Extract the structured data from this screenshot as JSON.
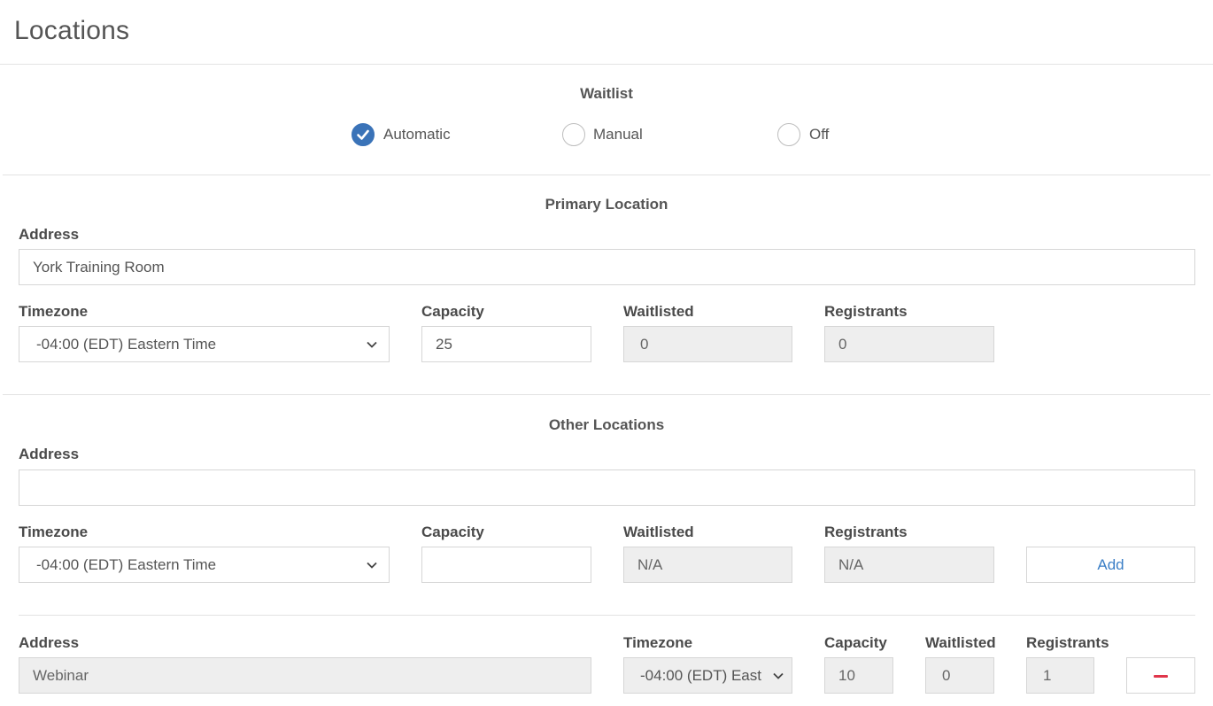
{
  "page": {
    "title": "Locations"
  },
  "waitlist": {
    "title": "Waitlist",
    "options": [
      {
        "label": "Automatic",
        "checked": true
      },
      {
        "label": "Manual",
        "checked": false
      },
      {
        "label": "Off",
        "checked": false
      }
    ]
  },
  "primary": {
    "title": "Primary Location",
    "address_label": "Address",
    "address_value": "York Training Room",
    "timezone_label": "Timezone",
    "timezone_value": "-04:00 (EDT) Eastern Time",
    "capacity_label": "Capacity",
    "capacity_value": "25",
    "waitlisted_label": "Waitlisted",
    "waitlisted_value": "0",
    "registrants_label": "Registrants",
    "registrants_value": "0"
  },
  "other": {
    "title": "Other Locations",
    "address_label": "Address",
    "address_value": "",
    "timezone_label": "Timezone",
    "timezone_value": "-04:00 (EDT) Eastern Time",
    "capacity_label": "Capacity",
    "capacity_value": "",
    "waitlisted_label": "Waitlisted",
    "waitlisted_value": "N/A",
    "registrants_label": "Registrants",
    "registrants_value": "N/A",
    "add_label": "Add"
  },
  "existing": {
    "address_label": "Address",
    "address_value": "Webinar",
    "timezone_label": "Timezone",
    "timezone_value": "-04:00 (EDT) East",
    "capacity_label": "Capacity",
    "capacity_value": "10",
    "waitlisted_label": "Waitlisted",
    "waitlisted_value": "0",
    "registrants_label": "Registrants",
    "registrants_value": "1"
  },
  "colors": {
    "accent": "#3a73b8",
    "link": "#3a7ec6",
    "danger": "#e0364b",
    "readonly_bg": "#eeeeee"
  },
  "icons": {
    "checked": "check-icon",
    "select": "chevron-down-icon",
    "remove": "minus-icon"
  }
}
